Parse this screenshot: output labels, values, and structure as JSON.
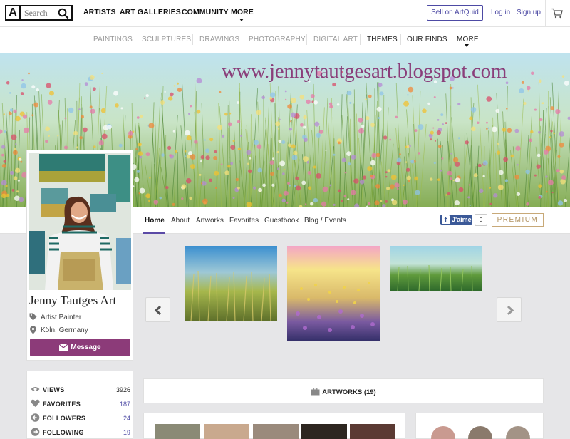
{
  "header": {
    "logo": "A",
    "search_placeholder": "Search",
    "nav": [
      "ARTISTS",
      "ART GALLERIES",
      "COMMUNITY",
      "MORE"
    ],
    "sell_label": "Sell on ArtQuid",
    "login_label": "Log in",
    "signup_label": "Sign up"
  },
  "categories": [
    "PAINTINGS",
    "SCULPTURES",
    "DRAWINGS",
    "PHOTOGRAPHY",
    "DIGITAL ART",
    "THEMES",
    "OUR FINDS",
    "MORE"
  ],
  "banner": {
    "url_text": "www.jennytautgesart.blogspot.com"
  },
  "profile_tabs": [
    "Home",
    "About",
    "Artworks",
    "Favorites",
    "Guestbook",
    "Blog / Events"
  ],
  "social": {
    "like_label": "J'aime",
    "like_count": "0",
    "premium_label": "PREMIUM"
  },
  "profile": {
    "name": "Jenny Tautges Art",
    "occupation": "Artist Painter",
    "location": "Köln, Germany",
    "message_label": "Message"
  },
  "stats": [
    {
      "label": "VIEWS",
      "value": "3926",
      "icon": "eye-icon"
    },
    {
      "label": "FAVORITES",
      "value": "187",
      "icon": "heart-icon"
    },
    {
      "label": "FOLLOWERS",
      "value": "24",
      "icon": "arrow-left-icon"
    },
    {
      "label": "FOLLOWING",
      "value": "19",
      "icon": "arrow-right-icon"
    }
  ],
  "artworks": {
    "label": "ARTWORKS (19)"
  },
  "colors": {
    "accent": "#4d4aa4",
    "message": "#8c3b79",
    "premium": "#c8a978",
    "banner_text": "#8a3e7a"
  }
}
